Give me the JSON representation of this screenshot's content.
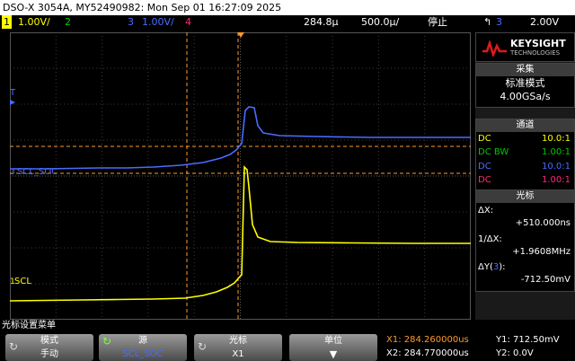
{
  "title": "DSO-X 3054A, MY52490982: Mon Sep 01 16:27:09 2025",
  "status_bar": {
    "ch1_num": "1",
    "ch1_scale": "1.00V/",
    "ch2_num": "2",
    "ch3_num": "3",
    "ch3_scale": "1.00V/",
    "ch4_num": "4",
    "time_delay": "284.8µ",
    "timebase": "500.0µ/",
    "run_state": "停止",
    "trigger_icon": "trigger-edge-icon",
    "trigger_ch": "3",
    "trigger_level": "2.00V"
  },
  "brand": {
    "name": "KEYSIGHT",
    "sub": "TECHNOLOGIES",
    "logo_icon": "keysight-wave-logo"
  },
  "acquisition": {
    "header": "采集",
    "mode": "标准模式",
    "rate": "4.00GSa/s"
  },
  "channels_panel": {
    "header": "通道",
    "rows": [
      {
        "coupling": "DC",
        "ratio": "10.0:1",
        "color": "#ffff00"
      },
      {
        "coupling": "DC BW",
        "ratio": "1.00:1",
        "color": "#00c800"
      },
      {
        "coupling": "DC",
        "ratio": "10.0:1",
        "color": "#4a6cff"
      },
      {
        "coupling": "DC",
        "ratio": "1.00:1",
        "color": "#ff2a7a"
      }
    ]
  },
  "cursors_panel": {
    "header": "光标",
    "dx_label": "ΔX:",
    "dx_value": "+510.000ns",
    "inv_label": "1/ΔX:",
    "inv_value": "+1.9608MHz",
    "dy_label": "ΔY(",
    "dy_ch": "3",
    "dy_close": "):",
    "dy_value": "-712.50mV"
  },
  "waveforms": {
    "ch3_label": "SCL_SOC",
    "ch1_label": "SCL",
    "ch1_color": "#ffff00",
    "ch3_color": "#4a6cff",
    "cursor_color": "#ff9a2a"
  },
  "menu": {
    "title": "光标设置菜单",
    "softkeys": [
      {
        "label": "模式",
        "value": "手动"
      },
      {
        "label": "源",
        "value": "SCL_SOC"
      },
      {
        "label": "光标",
        "value": "X1"
      },
      {
        "label": "单位",
        "value": ""
      }
    ]
  },
  "cursor_readout": {
    "x1": "X1: 284.260000us",
    "x2": "X2: 284.770000us",
    "y1": "Y1: 712.50mV",
    "y2": "Y2: 0.0V"
  }
}
